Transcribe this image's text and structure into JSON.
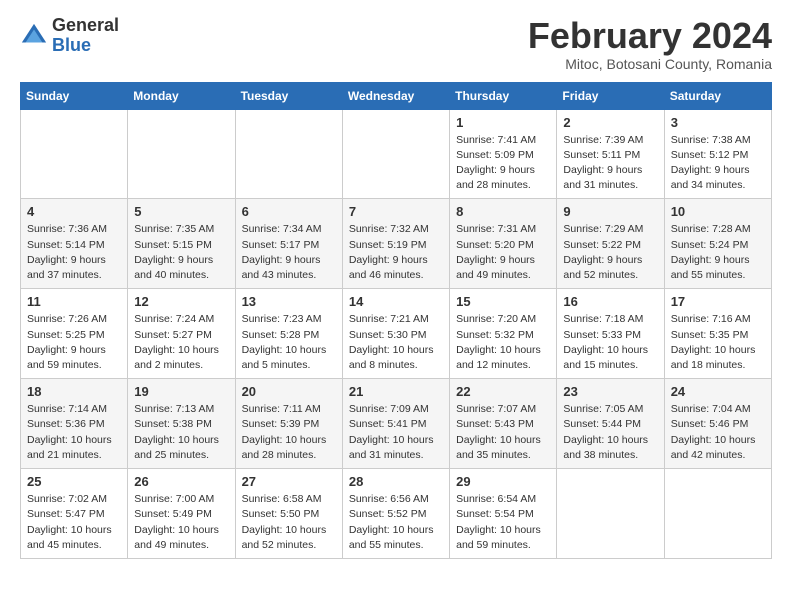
{
  "logo": {
    "general": "General",
    "blue": "Blue"
  },
  "header": {
    "month": "February 2024",
    "location": "Mitoc, Botosani County, Romania"
  },
  "days_of_week": [
    "Sunday",
    "Monday",
    "Tuesday",
    "Wednesday",
    "Thursday",
    "Friday",
    "Saturday"
  ],
  "weeks": [
    [
      {
        "day": "",
        "info": ""
      },
      {
        "day": "",
        "info": ""
      },
      {
        "day": "",
        "info": ""
      },
      {
        "day": "",
        "info": ""
      },
      {
        "day": "1",
        "info": "Sunrise: 7:41 AM\nSunset: 5:09 PM\nDaylight: 9 hours\nand 28 minutes."
      },
      {
        "day": "2",
        "info": "Sunrise: 7:39 AM\nSunset: 5:11 PM\nDaylight: 9 hours\nand 31 minutes."
      },
      {
        "day": "3",
        "info": "Sunrise: 7:38 AM\nSunset: 5:12 PM\nDaylight: 9 hours\nand 34 minutes."
      }
    ],
    [
      {
        "day": "4",
        "info": "Sunrise: 7:36 AM\nSunset: 5:14 PM\nDaylight: 9 hours\nand 37 minutes."
      },
      {
        "day": "5",
        "info": "Sunrise: 7:35 AM\nSunset: 5:15 PM\nDaylight: 9 hours\nand 40 minutes."
      },
      {
        "day": "6",
        "info": "Sunrise: 7:34 AM\nSunset: 5:17 PM\nDaylight: 9 hours\nand 43 minutes."
      },
      {
        "day": "7",
        "info": "Sunrise: 7:32 AM\nSunset: 5:19 PM\nDaylight: 9 hours\nand 46 minutes."
      },
      {
        "day": "8",
        "info": "Sunrise: 7:31 AM\nSunset: 5:20 PM\nDaylight: 9 hours\nand 49 minutes."
      },
      {
        "day": "9",
        "info": "Sunrise: 7:29 AM\nSunset: 5:22 PM\nDaylight: 9 hours\nand 52 minutes."
      },
      {
        "day": "10",
        "info": "Sunrise: 7:28 AM\nSunset: 5:24 PM\nDaylight: 9 hours\nand 55 minutes."
      }
    ],
    [
      {
        "day": "11",
        "info": "Sunrise: 7:26 AM\nSunset: 5:25 PM\nDaylight: 9 hours\nand 59 minutes."
      },
      {
        "day": "12",
        "info": "Sunrise: 7:24 AM\nSunset: 5:27 PM\nDaylight: 10 hours\nand 2 minutes."
      },
      {
        "day": "13",
        "info": "Sunrise: 7:23 AM\nSunset: 5:28 PM\nDaylight: 10 hours\nand 5 minutes."
      },
      {
        "day": "14",
        "info": "Sunrise: 7:21 AM\nSunset: 5:30 PM\nDaylight: 10 hours\nand 8 minutes."
      },
      {
        "day": "15",
        "info": "Sunrise: 7:20 AM\nSunset: 5:32 PM\nDaylight: 10 hours\nand 12 minutes."
      },
      {
        "day": "16",
        "info": "Sunrise: 7:18 AM\nSunset: 5:33 PM\nDaylight: 10 hours\nand 15 minutes."
      },
      {
        "day": "17",
        "info": "Sunrise: 7:16 AM\nSunset: 5:35 PM\nDaylight: 10 hours\nand 18 minutes."
      }
    ],
    [
      {
        "day": "18",
        "info": "Sunrise: 7:14 AM\nSunset: 5:36 PM\nDaylight: 10 hours\nand 21 minutes."
      },
      {
        "day": "19",
        "info": "Sunrise: 7:13 AM\nSunset: 5:38 PM\nDaylight: 10 hours\nand 25 minutes."
      },
      {
        "day": "20",
        "info": "Sunrise: 7:11 AM\nSunset: 5:39 PM\nDaylight: 10 hours\nand 28 minutes."
      },
      {
        "day": "21",
        "info": "Sunrise: 7:09 AM\nSunset: 5:41 PM\nDaylight: 10 hours\nand 31 minutes."
      },
      {
        "day": "22",
        "info": "Sunrise: 7:07 AM\nSunset: 5:43 PM\nDaylight: 10 hours\nand 35 minutes."
      },
      {
        "day": "23",
        "info": "Sunrise: 7:05 AM\nSunset: 5:44 PM\nDaylight: 10 hours\nand 38 minutes."
      },
      {
        "day": "24",
        "info": "Sunrise: 7:04 AM\nSunset: 5:46 PM\nDaylight: 10 hours\nand 42 minutes."
      }
    ],
    [
      {
        "day": "25",
        "info": "Sunrise: 7:02 AM\nSunset: 5:47 PM\nDaylight: 10 hours\nand 45 minutes."
      },
      {
        "day": "26",
        "info": "Sunrise: 7:00 AM\nSunset: 5:49 PM\nDaylight: 10 hours\nand 49 minutes."
      },
      {
        "day": "27",
        "info": "Sunrise: 6:58 AM\nSunset: 5:50 PM\nDaylight: 10 hours\nand 52 minutes."
      },
      {
        "day": "28",
        "info": "Sunrise: 6:56 AM\nSunset: 5:52 PM\nDaylight: 10 hours\nand 55 minutes."
      },
      {
        "day": "29",
        "info": "Sunrise: 6:54 AM\nSunset: 5:54 PM\nDaylight: 10 hours\nand 59 minutes."
      },
      {
        "day": "",
        "info": ""
      },
      {
        "day": "",
        "info": ""
      }
    ]
  ]
}
